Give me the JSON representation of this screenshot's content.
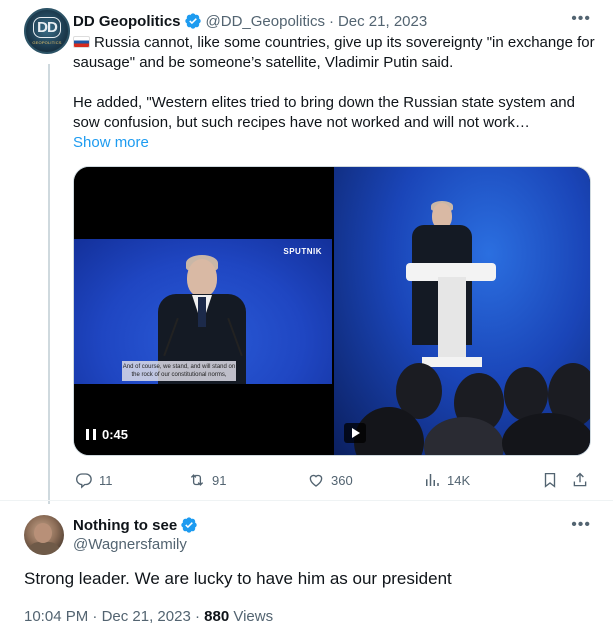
{
  "tweet": {
    "author_name": "DD Geopolitics",
    "author_handle": "@DD_Geopolitics",
    "separator": "·",
    "date": "Dec 21, 2023",
    "avatar_text": "DD",
    "avatar_subtext": "GEOPOLITICS",
    "paragraph1": "Russia cannot, like some countries, give up its sovereignty \"in exchange for sausage\" and be someone’s satellite, Vladimir Putin said.",
    "paragraph2": "He added, \"Western elites tried to bring down the Russian state system and sow confusion, but such recipes have not worked and will not work…",
    "show_more": "Show more",
    "media": {
      "video_time": "0:45",
      "watermark": "SPUTNIK",
      "subtitle": "And of course, we stand, and will stand on the rock of our constitutional norms,"
    },
    "actions": {
      "replies": "11",
      "reposts": "91",
      "likes": "360",
      "views": "14K"
    }
  },
  "reply": {
    "author_name": "Nothing to see",
    "author_handle": "@Wagnersfamily",
    "text": "Strong leader. We are lucky to have him as our president",
    "time": "10:04 PM",
    "separator": "·",
    "date": "Dec 21, 2023",
    "views_count": "880",
    "views_label": "Views"
  },
  "colors": {
    "accent": "#1d9bf0",
    "secondary_text": "#536471",
    "primary_text": "#0f1419"
  },
  "icons": [
    "verified-badge-icon",
    "more-options-icon",
    "reply-icon",
    "repost-icon",
    "like-icon",
    "views-icon",
    "bookmark-icon",
    "share-icon",
    "pause-icon",
    "play-icon",
    "russian-flag-icon"
  ]
}
